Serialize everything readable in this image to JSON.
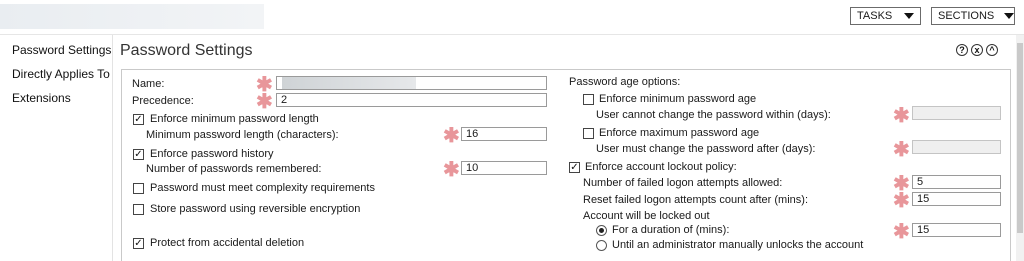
{
  "toolbar": {
    "tasks_label": "TASKS",
    "sections_label": "SECTIONS"
  },
  "sidebar": {
    "items": [
      {
        "label": "Password Settings"
      },
      {
        "label": "Directly Applies To"
      },
      {
        "label": "Extensions"
      }
    ]
  },
  "panel": {
    "title": "Password Settings",
    "help_icon": "?",
    "close_icon": "x",
    "collapse_icon": "^"
  },
  "left": {
    "name_label": "Name:",
    "precedence_label": "Precedence:",
    "precedence_value": "2",
    "enforce_min_length": {
      "label": "Enforce minimum password length",
      "checked": true
    },
    "min_length_label": "Minimum password length (characters):",
    "min_length_value": "16",
    "enforce_history": {
      "label": "Enforce password history",
      "checked": true
    },
    "history_label": "Number of passwords remembered:",
    "history_value": "10",
    "complexity": {
      "label": "Password must meet complexity requirements",
      "checked": false
    },
    "reversible": {
      "label": "Store password using reversible encryption",
      "checked": false
    },
    "protect": {
      "label": "Protect from accidental deletion",
      "checked": true
    }
  },
  "right": {
    "age_options_label": "Password age options:",
    "enforce_min_age": {
      "label": "Enforce minimum password age",
      "checked": false
    },
    "min_age_label": "User cannot change the password within (days):",
    "enforce_max_age": {
      "label": "Enforce maximum password age",
      "checked": false
    },
    "max_age_label": "User must change the password after (days):",
    "lockout": {
      "label": "Enforce account lockout policy:",
      "checked": true
    },
    "failed_attempts_label": "Number of failed logon attempts allowed:",
    "failed_attempts_value": "5",
    "reset_after_label": "Reset failed logon attempts count after (mins):",
    "reset_after_value": "15",
    "locked_out_label": "Account will be locked out",
    "duration_option": {
      "label": "For a duration of (mins):",
      "selected": true
    },
    "duration_value": "15",
    "admin_option": {
      "label": "Until an administrator manually unlocks the account",
      "selected": false
    }
  },
  "colors": {
    "required_star": "#e8969a",
    "border": "#c9c9c9"
  },
  "icons": {
    "check": "✓",
    "star": "✱"
  }
}
